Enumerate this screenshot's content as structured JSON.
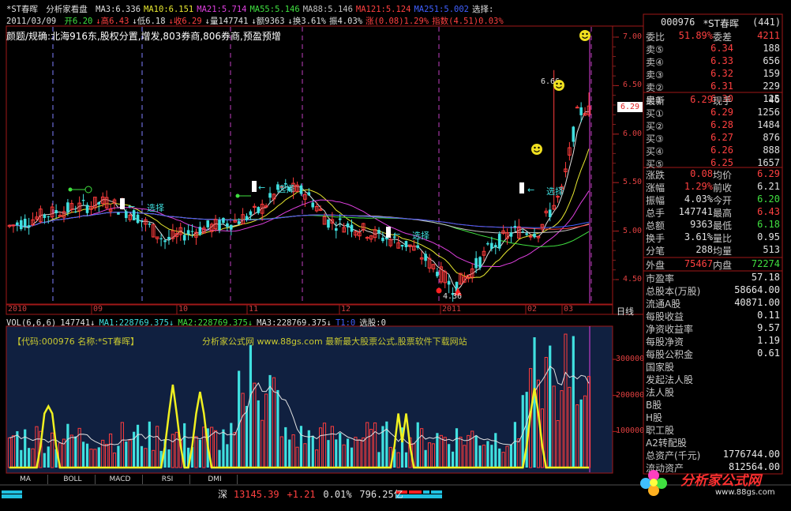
{
  "header": {
    "stock": "*ST春晖",
    "mode": "分析家看盘",
    "ma_items": [
      {
        "text": "MA3:6.336",
        "color": "#e0e0e0"
      },
      {
        "text": "MA10:6.151",
        "color": "#e8e830"
      },
      {
        "text": "MA21:5.714",
        "color": "#e040e0"
      },
      {
        "text": "MA55:5.146",
        "color": "#40e040"
      },
      {
        "text": "MA88:5.146",
        "color": "#c0c0c0"
      },
      {
        "text": "MA121:5.124",
        "color": "#ff4040"
      },
      {
        "text": "MA251:5.002",
        "color": "#4060ff"
      },
      {
        "text": "选择:",
        "color": "#e0e0e0"
      }
    ],
    "date": "2011/03/09",
    "ohlc_items": [
      {
        "text": "开6.20",
        "color": "#40e040"
      },
      {
        "text": "↓高6.43",
        "color": "#ff4040"
      },
      {
        "text": "↓低6.18",
        "color": "#e0e0e0"
      },
      {
        "text": "↓收6.29",
        "color": "#ff4040"
      },
      {
        "text": "↓量147741",
        "color": "#e0e0e0"
      },
      {
        "text": "↓额9363",
        "color": "#e0e0e0"
      },
      {
        "text": "↓换3.61%",
        "color": "#e0e0e0"
      },
      {
        "text": "振4.03%",
        "color": "#e0e0e0"
      },
      {
        "text": "涨(0.08)1.29%",
        "color": "#ff4040"
      },
      {
        "text": "指数(4.51)0.03%",
        "color": "#ff4040"
      }
    ],
    "news": "颜题/规确:北海916东,股权分置,增发,803券商,806券商,预盈预增"
  },
  "price_axis": [
    "7.00",
    "6.50",
    "6.00",
    "5.50",
    "5.00",
    "4.50"
  ],
  "current_price_tag": "6.29",
  "annotations": {
    "high_label": "6.66",
    "low_label": "4.36",
    "select_label": "选择"
  },
  "date_axis": [
    "2010",
    "09",
    "10",
    "11",
    "12",
    "2011",
    "02",
    "03"
  ],
  "period_button": "日线",
  "volume_header": {
    "items": [
      {
        "text": "VOL(6,6,6)",
        "color": "#e0e0e0"
      },
      {
        "text": "147741↓",
        "color": "#e0e0e0"
      },
      {
        "text": "MA1:228769.375↓",
        "color": "#40e0e0"
      },
      {
        "text": "MA2:228769.375↓",
        "color": "#40e040"
      },
      {
        "text": "MA3:228769.375↓",
        "color": "#e0e0e0"
      },
      {
        "text": "T1:0",
        "color": "#4060ff"
      },
      {
        "text": "选股:0",
        "color": "#e0e0e0"
      }
    ]
  },
  "banner": {
    "code": "【代码:000976  名称:*ST春晖】",
    "site": "分析家公式网 www.88gs.com 最新最大股票公式,股票软件下载网站"
  },
  "volume_axis": [
    "300000",
    "200000",
    "100000"
  ],
  "bottom_tabs": [
    "MA",
    "BOLL",
    "MACD",
    "RSI",
    "DMI"
  ],
  "status_bar": {
    "market": "深",
    "index": "13145.39",
    "change": "+1.21",
    "pct": "0.01%",
    "amount": "796.25亿"
  },
  "quote_panel": {
    "code": "000976",
    "name": "*ST春晖",
    "count": "(441)",
    "weibi_label": "委比",
    "weibi_value": "51.89%",
    "weicha_label": "委差",
    "weicha_value": "4211",
    "sells": [
      {
        "label": "卖⑤",
        "price": "6.34",
        "vol": "188"
      },
      {
        "label": "卖④",
        "price": "6.33",
        "vol": "656"
      },
      {
        "label": "卖③",
        "price": "6.32",
        "vol": "159"
      },
      {
        "label": "卖②",
        "price": "6.31",
        "vol": "229"
      },
      {
        "label": "卖①",
        "price": "6.30",
        "vol": "125"
      }
    ],
    "latest_label": "最新",
    "latest_value": "6.29",
    "xianshou_label": "现手",
    "xianshou_value": "46",
    "buys": [
      {
        "label": "买①",
        "price": "6.29",
        "vol": "1256"
      },
      {
        "label": "买②",
        "price": "6.28",
        "vol": "1484"
      },
      {
        "label": "买③",
        "price": "6.27",
        "vol": "876"
      },
      {
        "label": "买④",
        "price": "6.26",
        "vol": "888"
      },
      {
        "label": "买⑤",
        "price": "6.25",
        "vol": "1657"
      }
    ],
    "stats": [
      {
        "l1": "涨跌",
        "v1": "0.08",
        "l2": "均价",
        "v2": "6.29",
        "c1": "#ff4040",
        "c2": "#ff4040"
      },
      {
        "l1": "涨幅",
        "v1": "1.29%",
        "l2": "前收",
        "v2": "6.21",
        "c1": "#ff4040",
        "c2": "#e0e0e0"
      },
      {
        "l1": "振幅",
        "v1": "4.03%",
        "l2": "今开",
        "v2": "6.20",
        "c1": "#e0e0e0",
        "c2": "#40e040"
      },
      {
        "l1": "总手",
        "v1": "147741",
        "l2": "最高",
        "v2": "6.43",
        "c1": "#e0e0e0",
        "c2": "#ff4040"
      },
      {
        "l1": "总额",
        "v1": "9363",
        "l2": "最低",
        "v2": "6.18",
        "c1": "#e0e0e0",
        "c2": "#40e040"
      },
      {
        "l1": "换手",
        "v1": "3.61%",
        "l2": "量比",
        "v2": "0.95",
        "c1": "#e0e0e0",
        "c2": "#e0e0e0"
      },
      {
        "l1": "分笔",
        "v1": "288",
        "l2": "均量",
        "v2": "513",
        "c1": "#e0e0e0",
        "c2": "#e0e0e0"
      }
    ],
    "waipan_label": "外盘",
    "waipan_value": "75467",
    "neipan_label": "内盘",
    "neipan_value": "72274"
  },
  "financials": [
    {
      "label": "市盈率",
      "value": "57.18"
    },
    {
      "label": "总股本(万股)",
      "value": "58664.00"
    },
    {
      "label": "流通A股",
      "value": "40871.00"
    },
    {
      "label": "每股收益",
      "value": "0.11"
    },
    {
      "label": "净资收益率",
      "value": "9.57"
    },
    {
      "label": "每股净资",
      "value": "1.19"
    },
    {
      "label": "每股公积金",
      "value": "0.61"
    },
    {
      "label": "国家股",
      "value": ""
    },
    {
      "label": "发起法人股",
      "value": ""
    },
    {
      "label": "法人股",
      "value": ""
    },
    {
      "label": "B股",
      "value": ""
    },
    {
      "label": "H股",
      "value": ""
    },
    {
      "label": "职工股",
      "value": ""
    },
    {
      "label": "A2转配股",
      "value": ""
    },
    {
      "label": "总资产(千元)",
      "value": "1776744.00"
    },
    {
      "label": "流动资产",
      "value": "812564.00"
    }
  ],
  "logo": {
    "text": "分析家公式网",
    "url": "www.88gs.com"
  }
}
